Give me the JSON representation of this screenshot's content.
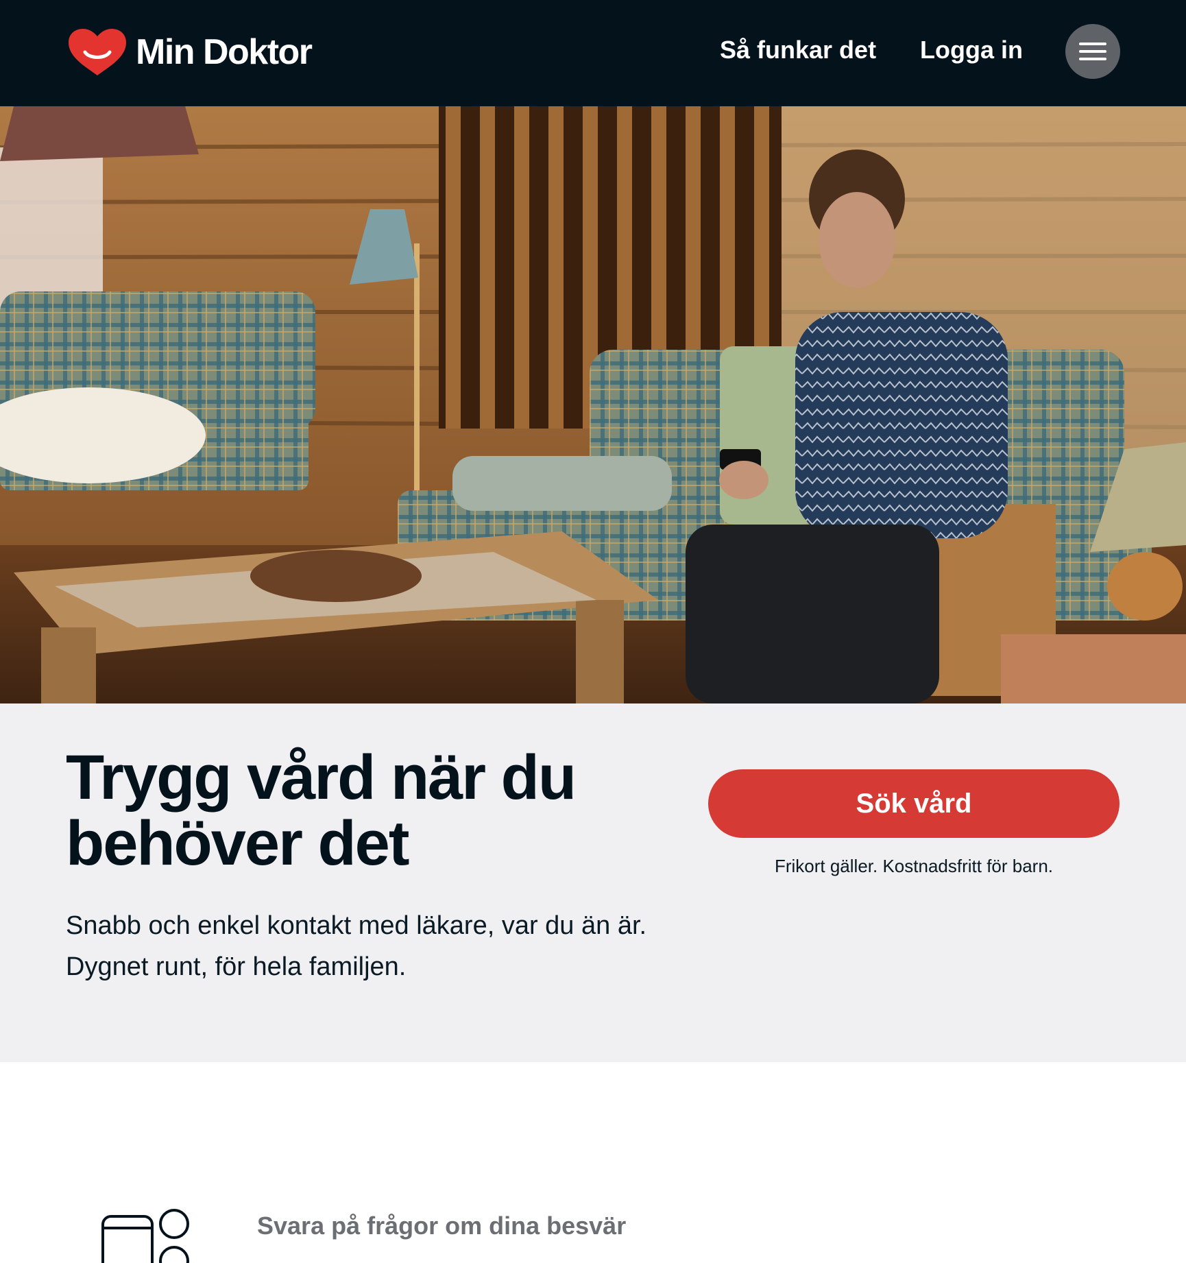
{
  "header": {
    "brand": "Min Doktor",
    "nav": {
      "how_it_works": "Så funkar det",
      "login": "Logga in"
    }
  },
  "hero": {
    "image": "man-on-sofa-with-phone-in-log-cabin"
  },
  "intro": {
    "headline": "Trygg vård när du behöver det",
    "subtext": "Snabb och enkel kontakt med läkare, var du än är. Dygnet runt, för hela familjen.",
    "cta_label": "Sök vård",
    "cta_note": "Frikort gäller. Kostnadsfritt för barn."
  },
  "steps": {
    "items": [
      {
        "icon": "phone-questions-icon",
        "label": "Svara på frågor om dina besvär"
      }
    ]
  },
  "colors": {
    "header_bg": "#04121c",
    "accent": "#d63a34",
    "panel_bg": "#f0eff1"
  }
}
